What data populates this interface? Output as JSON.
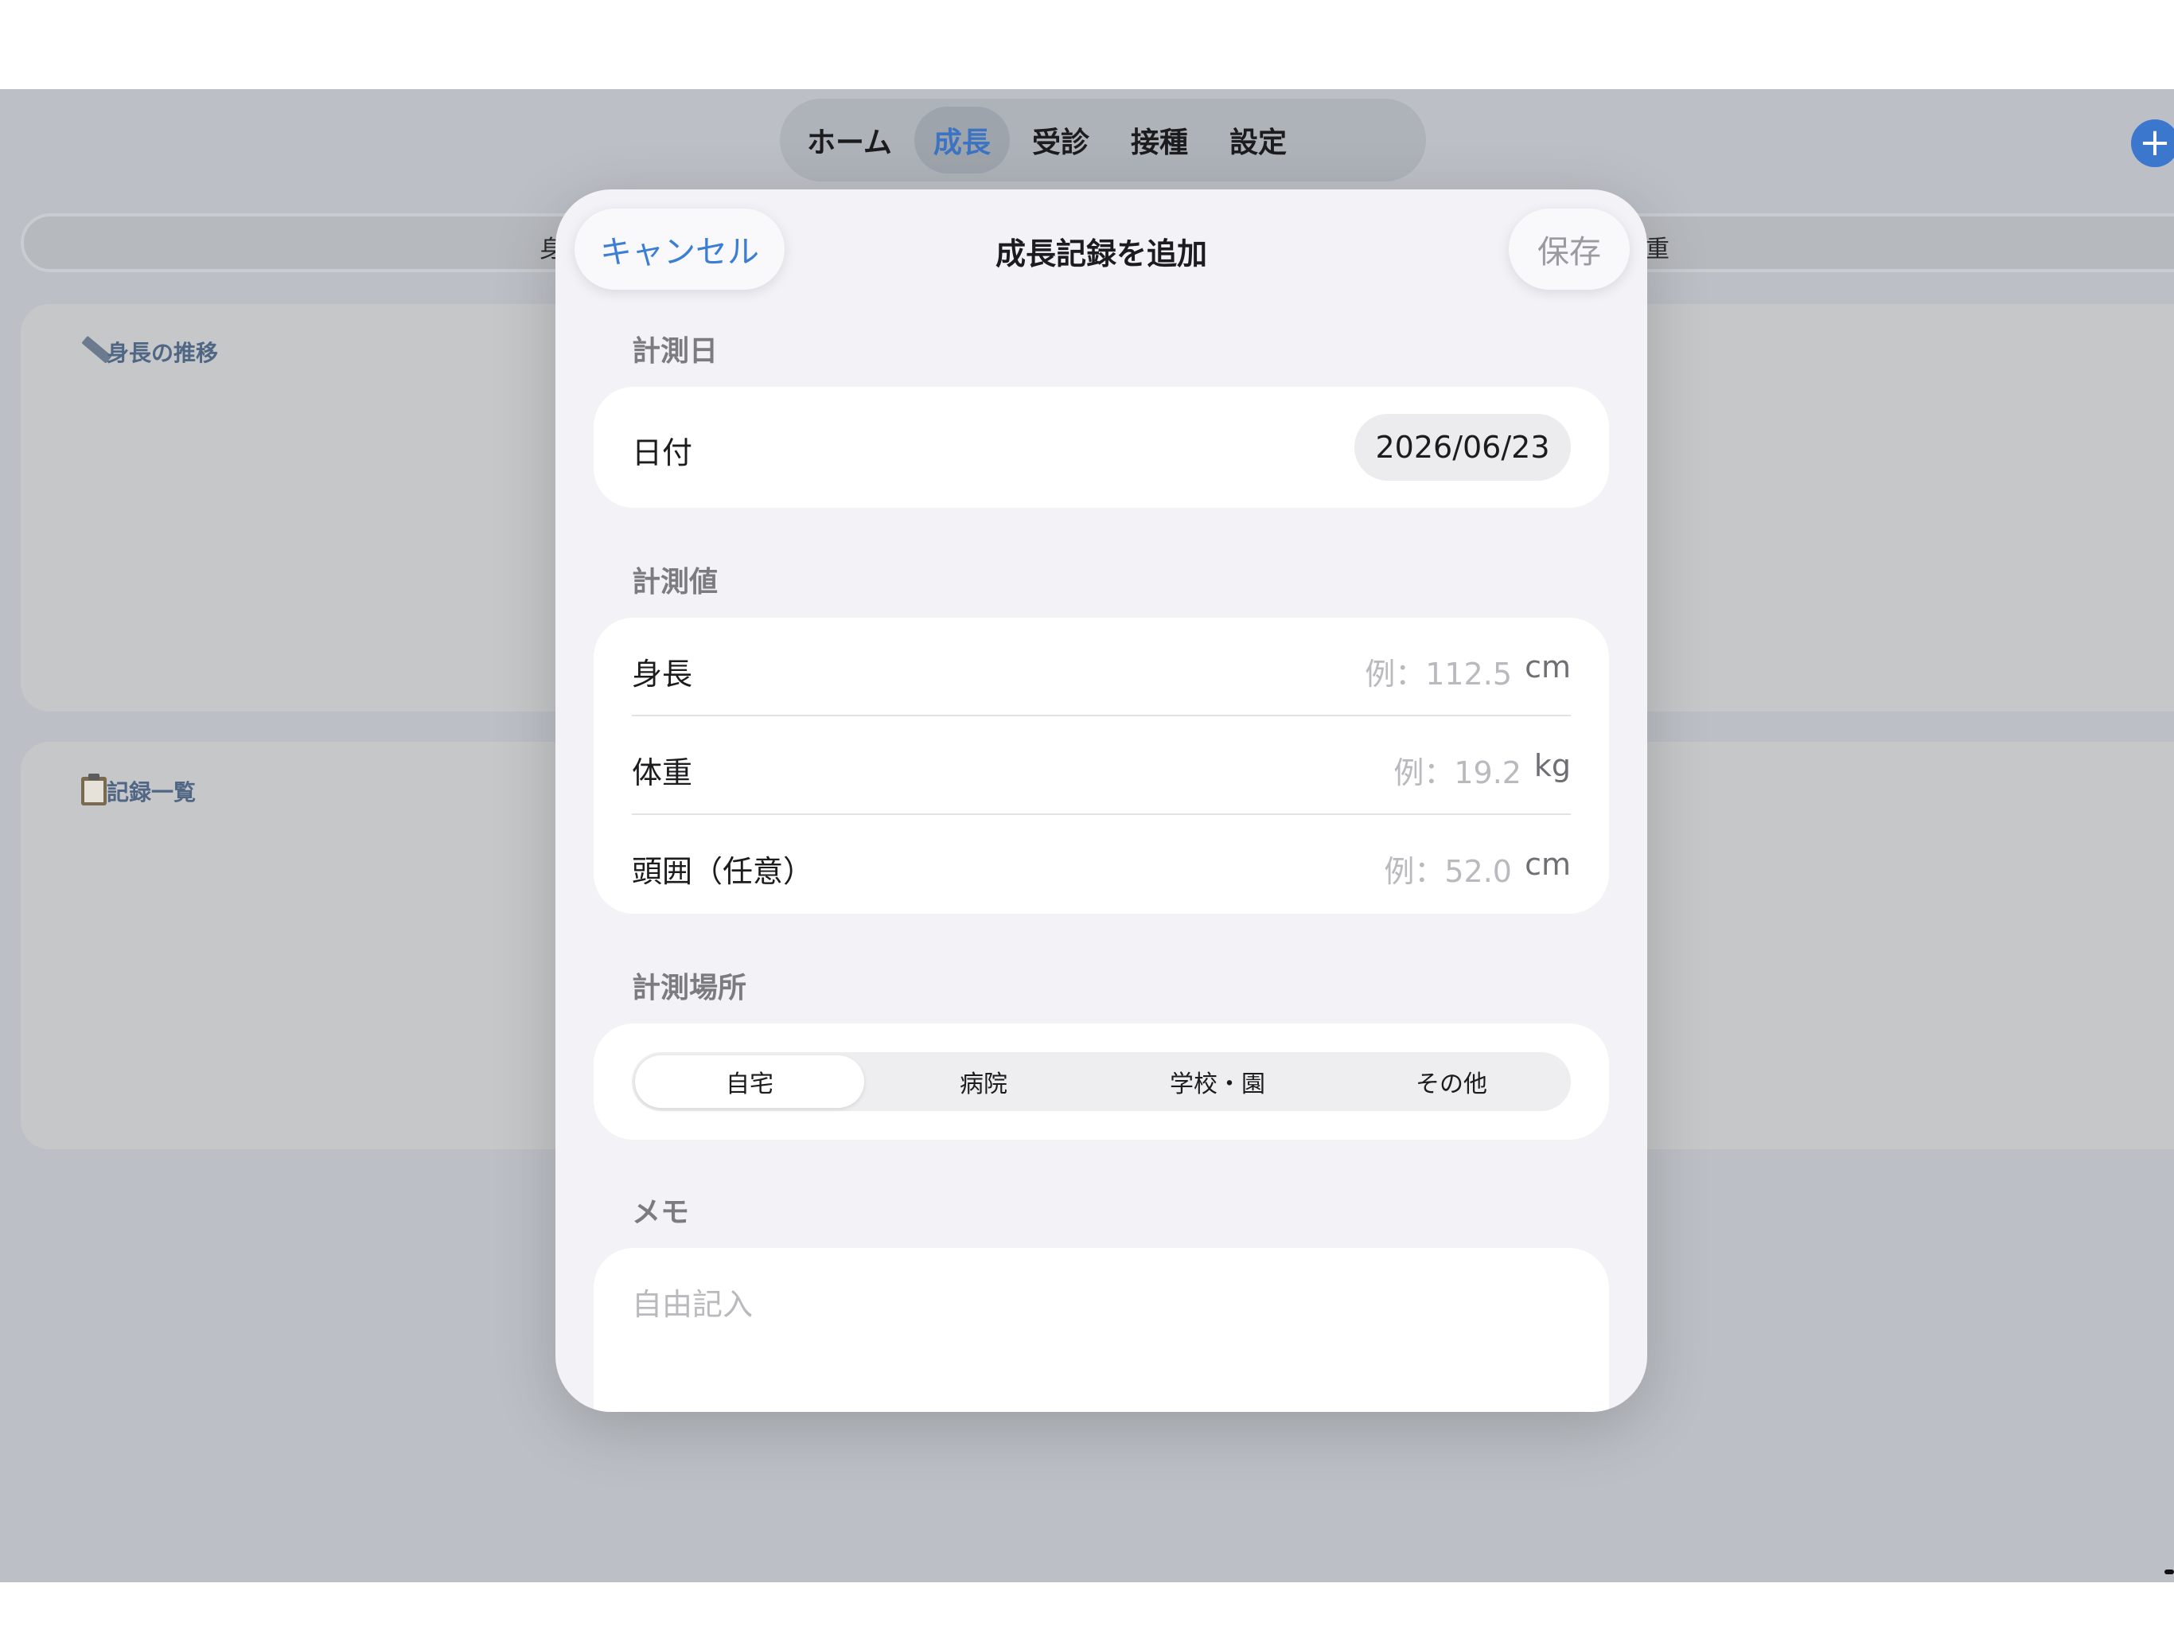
{
  "tabs": [
    {
      "label": "ホーム",
      "active": false
    },
    {
      "label": "成長",
      "active": true
    },
    {
      "label": "受診",
      "active": false
    },
    {
      "label": "接種",
      "active": false
    },
    {
      "label": "設定",
      "active": false
    }
  ],
  "add_button": "+",
  "background": {
    "segment_left": "身",
    "segment_right": "重",
    "height_card_title": "身長の推移",
    "records_card_title": "記録一覧"
  },
  "sheet": {
    "cancel": "キャンセル",
    "title": "成長記録を追加",
    "save": "保存",
    "date_section": "計測日",
    "date_label": "日付",
    "date_value": "2026/06/23",
    "values_section": "計測値",
    "height_label": "身長",
    "height_placeholder": "例：112.5",
    "height_unit": "cm",
    "weight_label": "体重",
    "weight_placeholder": "例：19.2",
    "weight_unit": "kg",
    "head_label": "頭囲（任意）",
    "head_placeholder": "例：52.0",
    "head_unit": "cm",
    "place_section": "計測場所",
    "place_options": [
      "自宅",
      "病院",
      "学校・園",
      "その他"
    ],
    "place_selected": "自宅",
    "memo_section": "メモ",
    "memo_placeholder": "自由記入"
  },
  "colors": {
    "accent": "#3c7ed4",
    "sheet_background": "#f2f2f7",
    "dim_background": "#bcc0c6"
  }
}
